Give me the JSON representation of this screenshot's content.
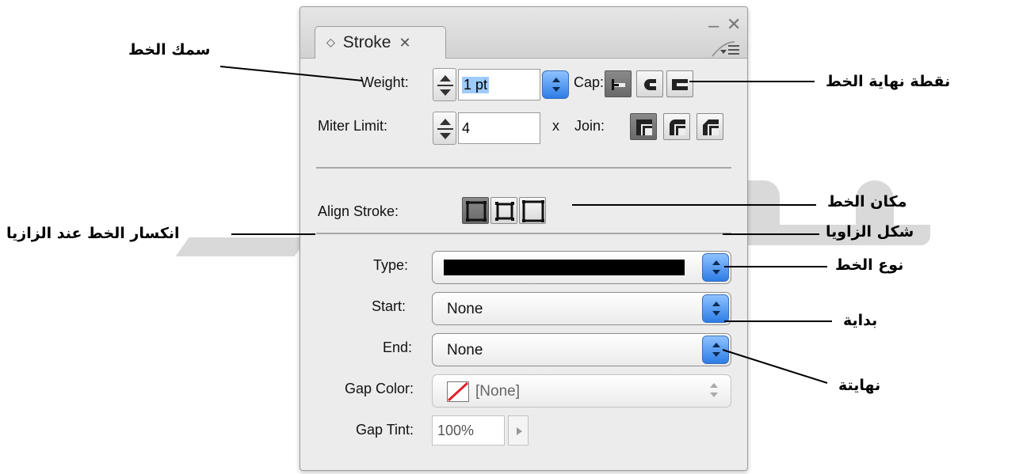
{
  "panel": {
    "tab_label": "Stroke",
    "tab_widget_icon": "disclosure-diamond-icon",
    "tab_close_icon": "close-icon",
    "window_controls": [
      "minimize-icon",
      "close-icon"
    ],
    "menu_icon": "panel-menu-icon"
  },
  "weight": {
    "label": "Weight:",
    "value": "1 pt"
  },
  "cap": {
    "label": "Cap:",
    "options": [
      "butt-cap-icon",
      "round-cap-icon",
      "projecting-cap-icon"
    ],
    "selected": 0
  },
  "miter": {
    "label": "Miter Limit:",
    "value": "4",
    "unit": "x"
  },
  "join": {
    "label": "Join:",
    "options": [
      "miter-join-icon",
      "round-join-icon",
      "bevel-join-icon"
    ],
    "selected": 0
  },
  "align": {
    "label": "Align Stroke:",
    "options": [
      "align-center-icon",
      "align-inside-icon",
      "align-outside-icon"
    ],
    "selected": 0
  },
  "type": {
    "label": "Type:"
  },
  "start": {
    "label": "Start:",
    "value": "None"
  },
  "end": {
    "label": "End:",
    "value": "None"
  },
  "gap_color": {
    "label": "Gap Color:",
    "value": "[None]"
  },
  "gap_tint": {
    "label": "Gap Tint:",
    "value": "100%"
  },
  "callouts": {
    "weight": "سمك الخط",
    "miter": "انكسار الخط عند الزازيا",
    "cap": "نقطة نهاية الخط",
    "join": "شكل الزاويا",
    "align": "مكان الخط",
    "type": "نوع الخط",
    "start": "بداية",
    "end": "نهايتة"
  },
  "colors": {
    "selected_text_bg": "#9ecbff",
    "popup_button": "#2d7de6",
    "no_color_slash": "#e0202a"
  }
}
